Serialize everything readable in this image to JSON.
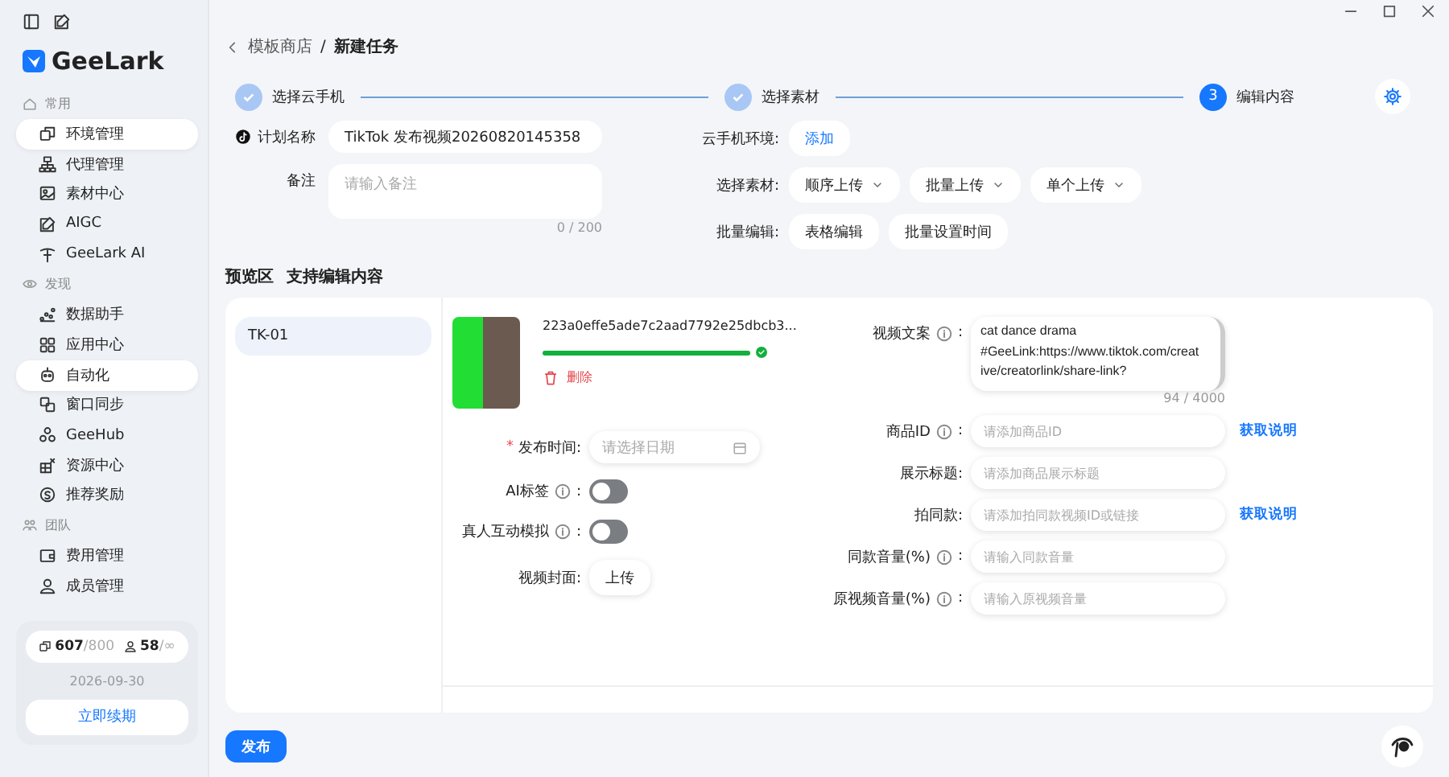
{
  "brand": {
    "name": "GeeLark"
  },
  "sidebar": {
    "sections": [
      {
        "title": "常用",
        "items": [
          {
            "label": "环境管理",
            "selected": true
          },
          {
            "label": "代理管理",
            "selected": false
          },
          {
            "label": "素材中心",
            "selected": false
          },
          {
            "label": "AIGC",
            "selected": false
          },
          {
            "label": "GeeLark AI",
            "selected": false
          }
        ]
      },
      {
        "title": "发现",
        "items": [
          {
            "label": "数据助手",
            "selected": false
          },
          {
            "label": "应用中心",
            "selected": false
          },
          {
            "label": "自动化",
            "selected": true
          },
          {
            "label": "窗口同步",
            "selected": false
          },
          {
            "label": "GeeHub",
            "selected": false
          },
          {
            "label": "资源中心",
            "selected": false
          },
          {
            "label": "推荐奖励",
            "selected": false
          }
        ]
      },
      {
        "title": "团队",
        "items": [
          {
            "label": "费用管理",
            "selected": false
          },
          {
            "label": "成员管理",
            "selected": false
          }
        ]
      }
    ],
    "quota": {
      "devices_used": "607",
      "devices_total": "/800",
      "members_used": "58",
      "members_total": "/∞",
      "expiry": "2026-09-30",
      "renew_button": "立即续期"
    }
  },
  "breadcrumb": {
    "parent": "模板商店",
    "separator": "/",
    "current": "新建任务"
  },
  "steps": [
    {
      "label": "选择云手机",
      "done": true
    },
    {
      "label": "选择素材",
      "done": true
    },
    {
      "number": "3",
      "label": "编辑内容",
      "done": false
    }
  ],
  "plan_form": {
    "name_label": "计划名称",
    "name_value": "TikTok 发布视频20260820145358",
    "note_label": "备注",
    "note_placeholder": "请输入备注",
    "note_count": "0 / 200"
  },
  "options": {
    "env_label": "云手机环境:",
    "env_button": "添加",
    "material_label": "选择素材:",
    "material_buttons": [
      "顺序上传",
      "批量上传",
      "单个上传"
    ],
    "batch_label": "批量编辑:",
    "batch_buttons": [
      "表格编辑",
      "批量设置时间"
    ]
  },
  "preview": {
    "title": "预览区",
    "subtitle": "支持编辑内容",
    "accounts": [
      {
        "label": "TK-01",
        "selected": true
      }
    ],
    "video": {
      "filename": "223a0effe5ade7c2aad7792e25dbcb3...",
      "level": 1.0,
      "delete_label": "删除"
    },
    "left_fields": [
      {
        "kind": "date",
        "required_mark": "*",
        "label": "发布时间:",
        "placeholder": "请选择日期"
      },
      {
        "kind": "toggle",
        "label": "AI标签",
        "info": true,
        "colon": ":",
        "on": false
      },
      {
        "kind": "toggle",
        "label": "真人互动模拟",
        "info": true,
        "colon": ":",
        "on": false
      },
      {
        "kind": "upload",
        "label": "视频封面:",
        "button": "上传"
      }
    ],
    "right_fields": [
      {
        "kind": "textarea",
        "label": "视频文案",
        "info": true,
        "colon": ":",
        "value": "cat dance drama\n#GeeLink:https://www.tiktok.com/creat\nive/creatorlink/share-link?",
        "count": "94 / 4000"
      },
      {
        "kind": "input",
        "label": "商品ID",
        "info": true,
        "colon": ":",
        "placeholder": "请添加商品ID",
        "link": "获取说明"
      },
      {
        "kind": "input",
        "label": "展示标题:",
        "info": false,
        "placeholder": "请添加商品展示标题"
      },
      {
        "kind": "input",
        "label": "拍同款:",
        "info": false,
        "placeholder": "请添加拍同款视频ID或链接",
        "link": "获取说明"
      },
      {
        "kind": "input",
        "label": "同款音量(%)",
        "info": true,
        "colon": ":",
        "placeholder": "请输入同款音量"
      },
      {
        "kind": "input",
        "label": "原视频音量(%)",
        "info": true,
        "colon": ":",
        "placeholder": "请输入原视频音量"
      }
    ]
  },
  "publish_button": "发布"
}
